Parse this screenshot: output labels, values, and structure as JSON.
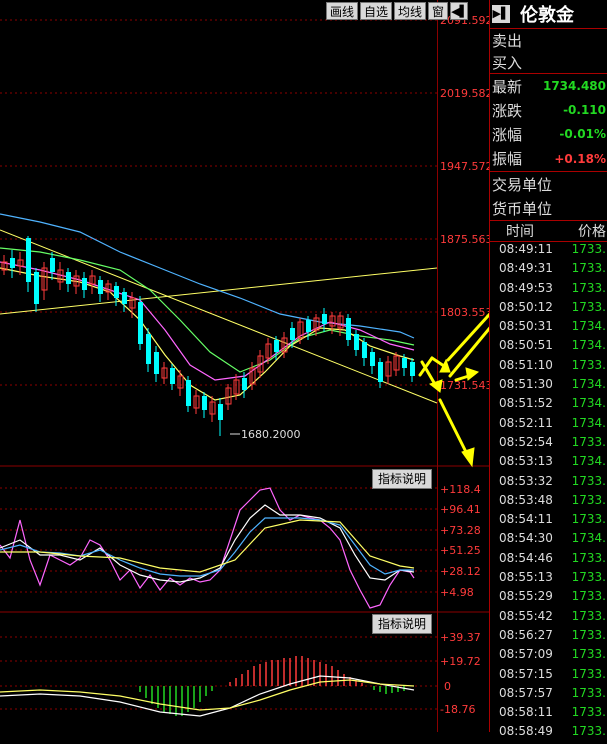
{
  "toolbar": {
    "draw_label": "画线",
    "self_select_label": "自选",
    "ma_label": "均线",
    "window_label": "窗"
  },
  "price_axis": [
    "2091.592",
    "2019.582",
    "1947.572",
    "1875.563",
    "1803.553",
    "1731.543"
  ],
  "low_annotation": "1680.2000",
  "indicator1": {
    "button_label": "指标说明",
    "ticks": [
      "+118.4",
      "+96.41",
      "+73.28",
      "+51.25",
      "+28.12",
      "+4.98"
    ]
  },
  "indicator2": {
    "button_label": "指标说明",
    "ticks": [
      "+39.37",
      "+19.72",
      "0",
      "-18.76"
    ]
  },
  "panel": {
    "title": "伦敦金",
    "sell_label": "卖出",
    "buy_label": "买入",
    "latest_label": "最新",
    "latest_value": "1734.480",
    "change_label": "涨跌",
    "change_value": "-0.110",
    "change_pct_label": "涨幅",
    "change_pct_value": "-0.01%",
    "amplitude_label": "振幅",
    "amplitude_value": "+0.18%",
    "trade_unit_label": "交易单位",
    "currency_unit_label": "货币单位",
    "time_header": "时间",
    "price_header": "价格",
    "trades": [
      {
        "time": "08:49:11",
        "price": "1733."
      },
      {
        "time": "08:49:31",
        "price": "1733."
      },
      {
        "time": "08:49:53",
        "price": "1733."
      },
      {
        "time": "08:50:12",
        "price": "1733."
      },
      {
        "time": "08:50:31",
        "price": "1734."
      },
      {
        "time": "08:50:51",
        "price": "1734."
      },
      {
        "time": "08:51:10",
        "price": "1733."
      },
      {
        "time": "08:51:30",
        "price": "1734."
      },
      {
        "time": "08:51:52",
        "price": "1734."
      },
      {
        "time": "08:52:11",
        "price": "1734."
      },
      {
        "time": "08:52:54",
        "price": "1733."
      },
      {
        "time": "08:53:13",
        "price": "1734."
      },
      {
        "time": "08:53:32",
        "price": "1733."
      },
      {
        "time": "08:53:48",
        "price": "1733."
      },
      {
        "time": "08:54:11",
        "price": "1733."
      },
      {
        "time": "08:54:30",
        "price": "1734."
      },
      {
        "time": "08:54:46",
        "price": "1733."
      },
      {
        "time": "08:55:13",
        "price": "1733."
      },
      {
        "time": "08:55:29",
        "price": "1733."
      },
      {
        "time": "08:55:42",
        "price": "1733."
      },
      {
        "time": "08:56:27",
        "price": "1733."
      },
      {
        "time": "08:57:09",
        "price": "1733."
      },
      {
        "time": "08:57:15",
        "price": "1733."
      },
      {
        "time": "08:57:57",
        "price": "1733."
      },
      {
        "time": "08:58:11",
        "price": "1733."
      },
      {
        "time": "08:58:49",
        "price": "1733."
      }
    ]
  },
  "colors": {
    "up": "#ff3b3b",
    "down": "#00ffff",
    "grid": "#8b0000",
    "arrow": "#ffff00"
  }
}
